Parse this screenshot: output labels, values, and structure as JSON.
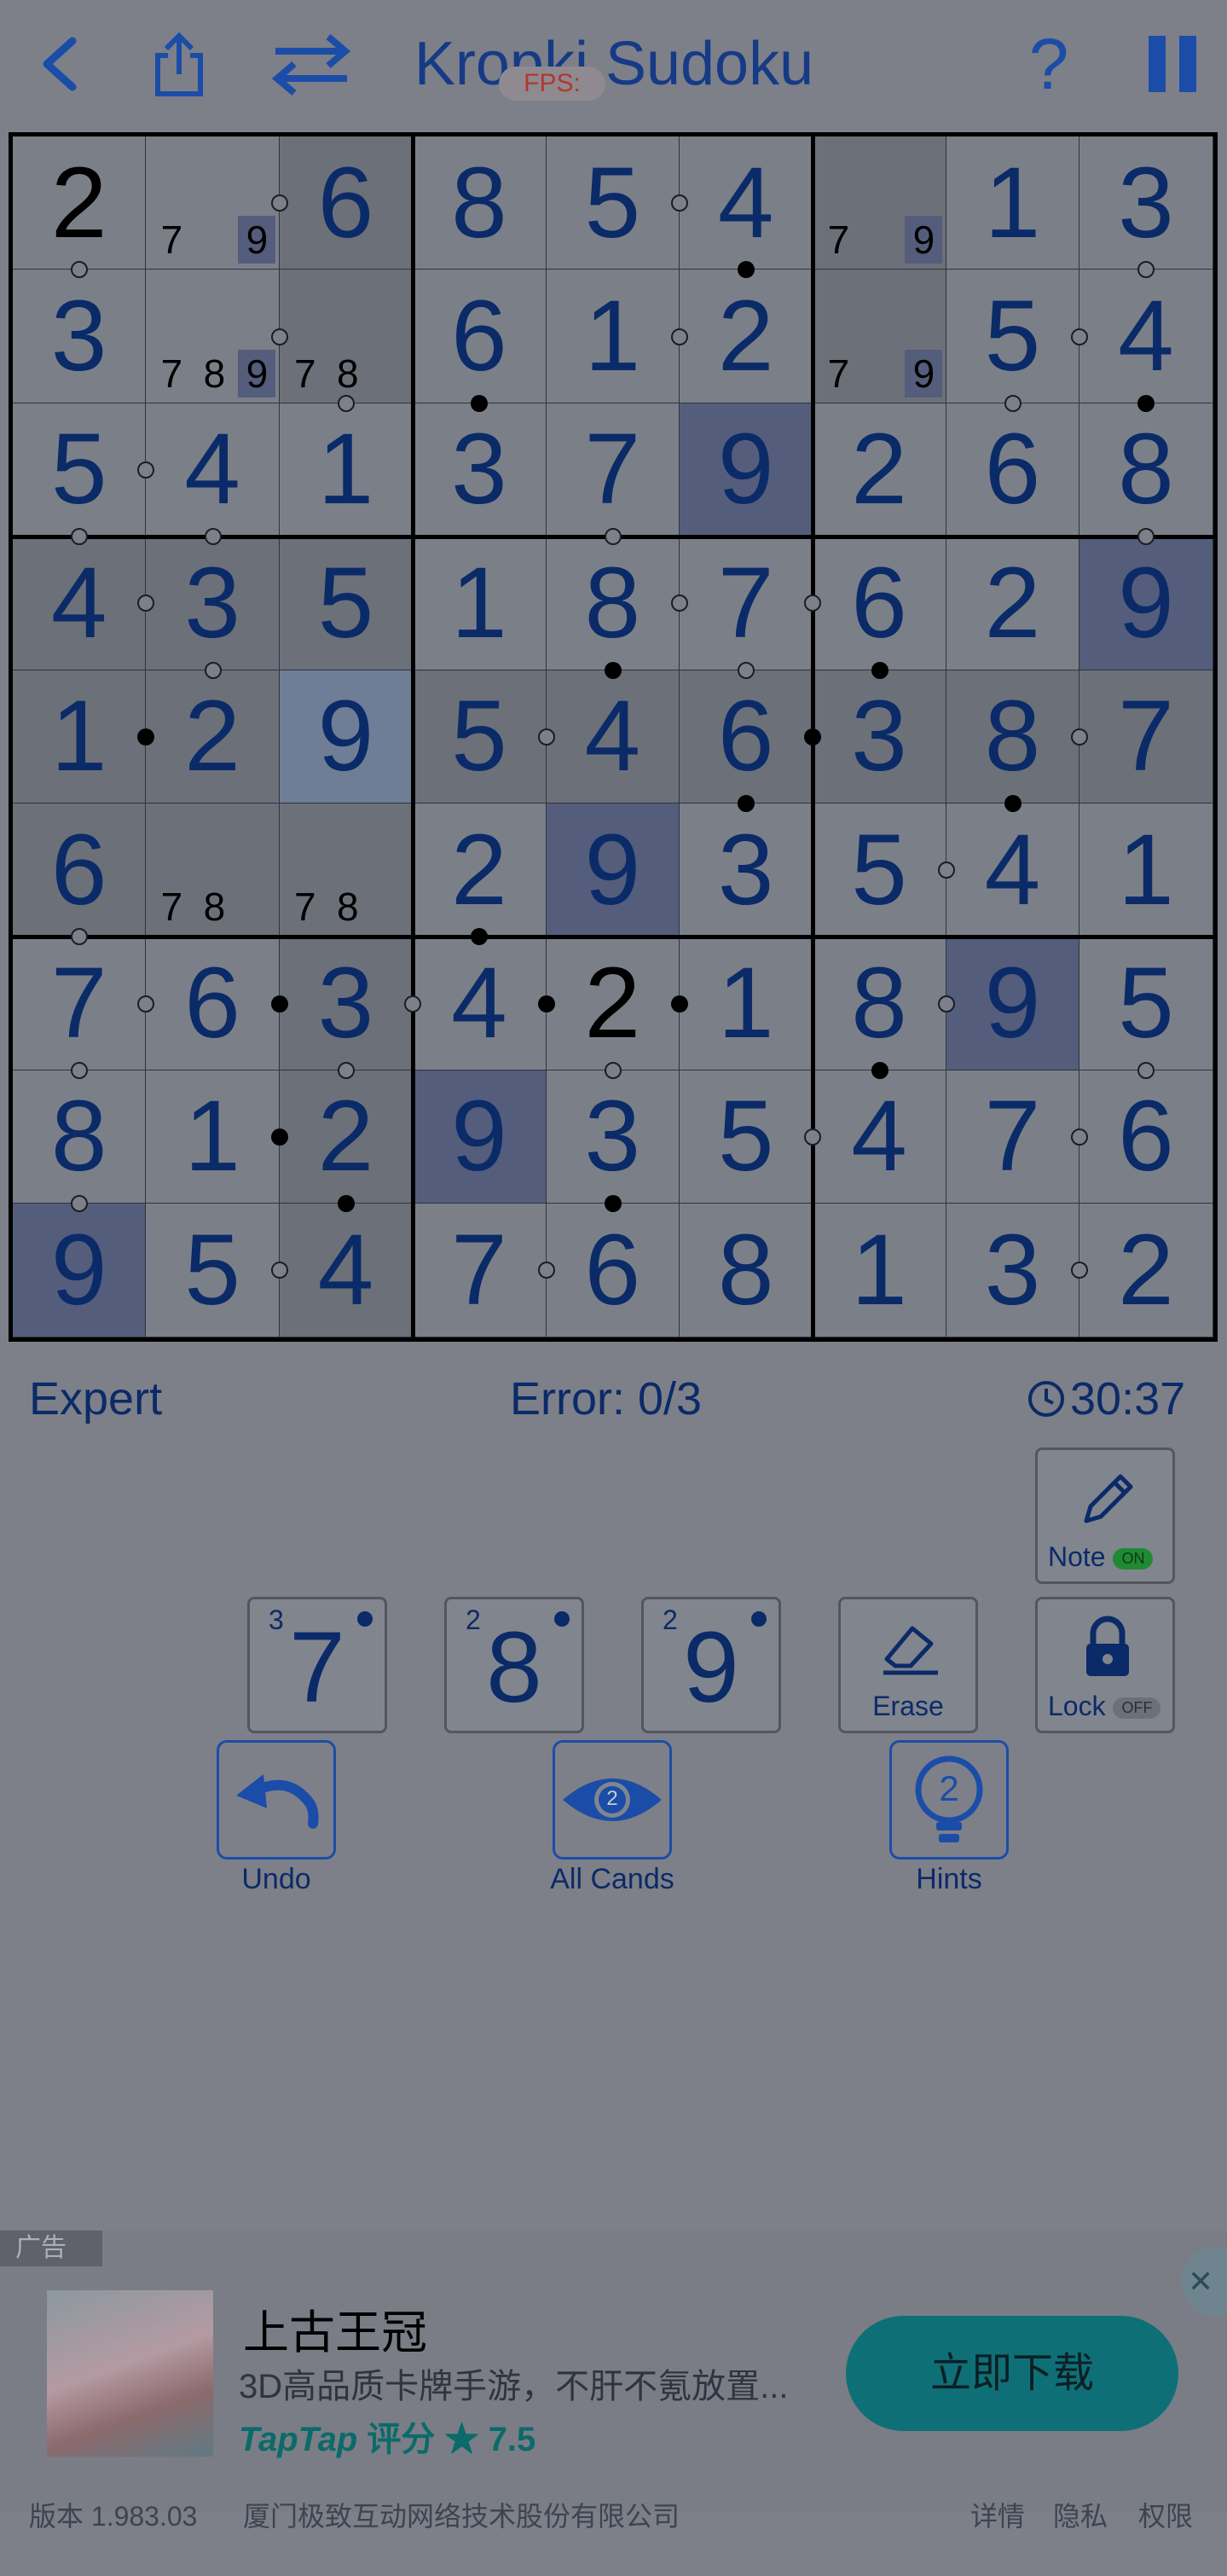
{
  "header": {
    "title": "Kropki Sudoku",
    "fps_badge": "FPS:",
    "icons": [
      "chevron-left-icon",
      "share-icon",
      "swap-icon",
      "help-icon",
      "pause-icon"
    ]
  },
  "board": {
    "values": [
      [
        "2",
        "",
        "6",
        "8",
        "5",
        "4",
        "",
        "1",
        "3"
      ],
      [
        "3",
        "",
        "",
        "6",
        "1",
        "2",
        "",
        "5",
        "4"
      ],
      [
        "5",
        "4",
        "1",
        "3",
        "7",
        "9",
        "2",
        "6",
        "8"
      ],
      [
        "4",
        "3",
        "5",
        "1",
        "8",
        "7",
        "6",
        "2",
        "9"
      ],
      [
        "1",
        "2",
        "9",
        "5",
        "4",
        "6",
        "3",
        "8",
        "7"
      ],
      [
        "6",
        "",
        "",
        "2",
        "9",
        "3",
        "5",
        "4",
        "1"
      ],
      [
        "7",
        "6",
        "3",
        "4",
        "2",
        "1",
        "8",
        "9",
        "5"
      ],
      [
        "8",
        "1",
        "2",
        "9",
        "3",
        "5",
        "4",
        "7",
        "6"
      ],
      [
        "9",
        "5",
        "4",
        "7",
        "6",
        "8",
        "1",
        "3",
        "2"
      ]
    ],
    "given": [
      [
        0,
        0
      ],
      [
        6,
        4
      ]
    ],
    "highlight_blue": [
      [
        2,
        5
      ],
      [
        3,
        8
      ],
      [
        5,
        4
      ],
      [
        6,
        7
      ],
      [
        7,
        3
      ],
      [
        8,
        0
      ]
    ],
    "highlight_light": [
      [
        4,
        2
      ]
    ],
    "highlight_gray": [
      [
        0,
        2
      ],
      [
        1,
        2
      ],
      [
        5,
        1
      ],
      [
        5,
        2
      ],
      [
        3,
        0
      ],
      [
        3,
        1
      ],
      [
        3,
        2
      ],
      [
        4,
        0
      ],
      [
        4,
        1
      ],
      [
        5,
        0
      ],
      [
        4,
        3
      ],
      [
        4,
        4
      ],
      [
        4,
        5
      ],
      [
        4,
        6
      ],
      [
        4,
        7
      ],
      [
        4,
        8
      ],
      [
        6,
        2
      ],
      [
        7,
        2
      ],
      [
        8,
        2
      ],
      [
        0,
        6
      ],
      [
        1,
        6
      ]
    ],
    "notes": {
      "0-1": [
        {
          "d": "7",
          "slot": 0,
          "hl": false
        },
        {
          "d": "9",
          "slot": 2,
          "hl": true
        }
      ],
      "0-6": [
        {
          "d": "7",
          "slot": 0,
          "hl": false
        },
        {
          "d": "9",
          "slot": 2,
          "hl": true
        }
      ],
      "1-1": [
        {
          "d": "7",
          "slot": 0,
          "hl": false
        },
        {
          "d": "8",
          "slot": 1,
          "hl": false
        },
        {
          "d": "9",
          "slot": 2,
          "hl": true
        }
      ],
      "1-2": [
        {
          "d": "7",
          "slot": 0,
          "hl": false
        },
        {
          "d": "8",
          "slot": 1,
          "hl": false
        }
      ],
      "1-6": [
        {
          "d": "7",
          "slot": 0,
          "hl": false
        },
        {
          "d": "9",
          "slot": 2,
          "hl": true
        }
      ],
      "5-1": [
        {
          "d": "7",
          "slot": 0,
          "hl": false
        },
        {
          "d": "8",
          "slot": 1,
          "hl": false
        }
      ],
      "5-2": [
        {
          "d": "7",
          "slot": 0,
          "hl": false
        },
        {
          "d": "8",
          "slot": 1,
          "hl": false
        }
      ]
    },
    "dots_h": [
      {
        "r": 0,
        "c": 1,
        "t": "w"
      },
      {
        "r": 0,
        "c": 4,
        "t": "w"
      },
      {
        "r": 1,
        "c": 1,
        "t": "w"
      },
      {
        "r": 1,
        "c": 4,
        "t": "w"
      },
      {
        "r": 1,
        "c": 7,
        "t": "w"
      },
      {
        "r": 2,
        "c": 0,
        "t": "w"
      },
      {
        "r": 3,
        "c": 0,
        "t": "w"
      },
      {
        "r": 3,
        "c": 4,
        "t": "w"
      },
      {
        "r": 3,
        "c": 5,
        "t": "w"
      },
      {
        "r": 4,
        "c": 0,
        "t": "b"
      },
      {
        "r": 4,
        "c": 3,
        "t": "w"
      },
      {
        "r": 4,
        "c": 5,
        "t": "b"
      },
      {
        "r": 4,
        "c": 7,
        "t": "w"
      },
      {
        "r": 5,
        "c": 6,
        "t": "w"
      },
      {
        "r": 6,
        "c": 0,
        "t": "w"
      },
      {
        "r": 6,
        "c": 1,
        "t": "b"
      },
      {
        "r": 6,
        "c": 2,
        "t": "w"
      },
      {
        "r": 6,
        "c": 3,
        "t": "b"
      },
      {
        "r": 6,
        "c": 4,
        "t": "b"
      },
      {
        "r": 6,
        "c": 6,
        "t": "w"
      },
      {
        "r": 7,
        "c": 1,
        "t": "b"
      },
      {
        "r": 7,
        "c": 5,
        "t": "w"
      },
      {
        "r": 7,
        "c": 7,
        "t": "w"
      },
      {
        "r": 8,
        "c": 1,
        "t": "w"
      },
      {
        "r": 8,
        "c": 3,
        "t": "w"
      },
      {
        "r": 8,
        "c": 7,
        "t": "w"
      }
    ],
    "dots_v": [
      {
        "r": 0,
        "c": 0,
        "t": "w"
      },
      {
        "r": 0,
        "c": 5,
        "t": "b"
      },
      {
        "r": 0,
        "c": 8,
        "t": "w"
      },
      {
        "r": 1,
        "c": 2,
        "t": "w"
      },
      {
        "r": 1,
        "c": 3,
        "t": "b"
      },
      {
        "r": 1,
        "c": 7,
        "t": "w"
      },
      {
        "r": 1,
        "c": 8,
        "t": "b"
      },
      {
        "r": 2,
        "c": 0,
        "t": "w"
      },
      {
        "r": 2,
        "c": 1,
        "t": "w"
      },
      {
        "r": 2,
        "c": 4,
        "t": "w"
      },
      {
        "r": 2,
        "c": 8,
        "t": "w"
      },
      {
        "r": 3,
        "c": 1,
        "t": "w"
      },
      {
        "r": 3,
        "c": 4,
        "t": "b"
      },
      {
        "r": 3,
        "c": 5,
        "t": "w"
      },
      {
        "r": 3,
        "c": 6,
        "t": "b"
      },
      {
        "r": 4,
        "c": 5,
        "t": "b"
      },
      {
        "r": 4,
        "c": 7,
        "t": "b"
      },
      {
        "r": 5,
        "c": 0,
        "t": "w"
      },
      {
        "r": 5,
        "c": 3,
        "t": "b"
      },
      {
        "r": 6,
        "c": 0,
        "t": "w"
      },
      {
        "r": 6,
        "c": 2,
        "t": "w"
      },
      {
        "r": 6,
        "c": 4,
        "t": "w"
      },
      {
        "r": 6,
        "c": 6,
        "t": "b"
      },
      {
        "r": 6,
        "c": 8,
        "t": "w"
      },
      {
        "r": 7,
        "c": 0,
        "t": "w"
      },
      {
        "r": 7,
        "c": 2,
        "t": "b"
      },
      {
        "r": 7,
        "c": 4,
        "t": "b"
      }
    ]
  },
  "status": {
    "difficulty": "Expert",
    "errors": "Error: 0/3",
    "timer": "30:37"
  },
  "controls": {
    "digits": [
      {
        "digit": "7",
        "count": "3"
      },
      {
        "digit": "8",
        "count": "2"
      },
      {
        "digit": "9",
        "count": "2"
      }
    ],
    "note_label": "Note",
    "note_state": "ON",
    "erase_label": "Erase",
    "lock_label": "Lock",
    "lock_state": "OFF",
    "undo_label": "Undo",
    "all_cands_label": "All Cands",
    "all_cands_count": "2",
    "hints_label": "Hints",
    "hints_count": "2"
  },
  "ad": {
    "tag": "广告",
    "title": "上古王冠",
    "description": "3D高品质卡牌手游，不肝不氪放置...",
    "rating_brand": "TapTap",
    "rating_text": "评分 ★ 7.5",
    "button": "立即下载",
    "close": "✕",
    "footer_left": "版本 1.983.03",
    "footer_company": "厦门极致互动网络技术股份有限公司",
    "footer_links": [
      "详情",
      "隐私",
      "权限"
    ]
  },
  "colors": {
    "background": "#7d8088",
    "digit": "#0b2a68",
    "given_digit": "#000000",
    "highlight": "#545d7b",
    "accent": "#163a86",
    "note_on": "#1f8a33",
    "ad_button": "#0f6f76"
  }
}
